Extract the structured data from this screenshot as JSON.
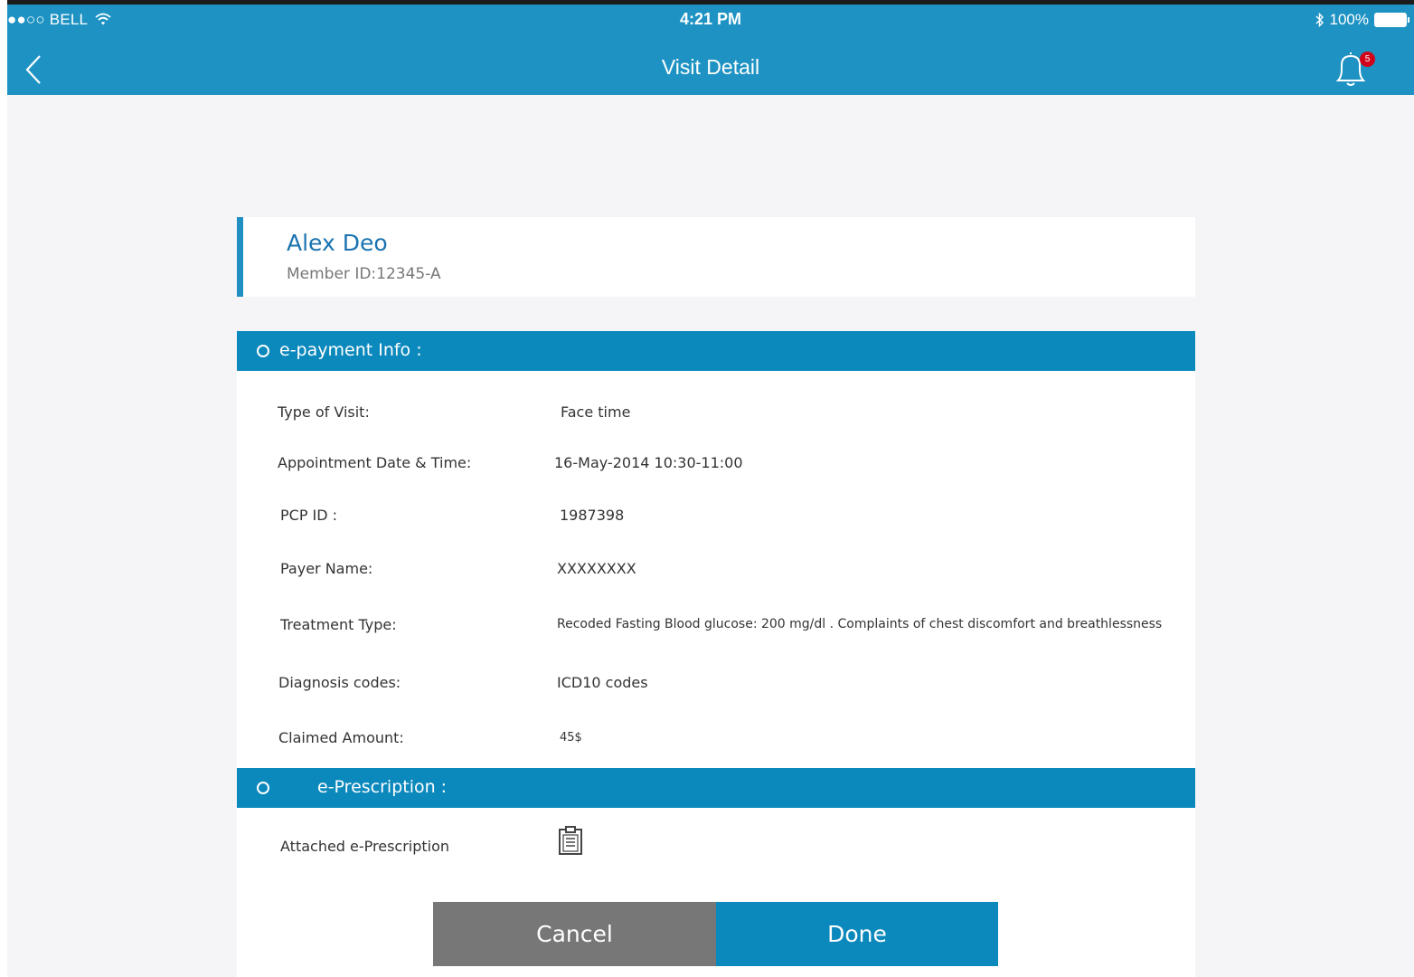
{
  "status_bar": {
    "carrier": "●●○○ BELL",
    "wifi_icon": "wifi-icon",
    "time": "4:21 PM",
    "bluetooth_icon": "bluetooth-icon",
    "battery": "100%"
  },
  "nav": {
    "title": "Visit Detail",
    "back_icon": "chevron-left-icon",
    "bell_icon": "bell-icon",
    "notification_count": "5"
  },
  "member": {
    "name": "Alex Deo",
    "member_id": "Member ID:12345-A"
  },
  "payment_section": {
    "title": "e-payment Info :",
    "rows": [
      {
        "label": "Type of Visit:",
        "value": "Face time"
      },
      {
        "label": "Appointment Date & Time:",
        "value": "16-May-2014 10:30-11:00"
      },
      {
        "label": "PCP ID :",
        "value": "1987398"
      },
      {
        "label": "Payer Name:",
        "value": "XXXXXXXX"
      },
      {
        "label": "Treatment Type:",
        "value": "Recoded Fasting Blood glucose: 200 mg/dl . Complaints of chest discomfort and breathlessness"
      },
      {
        "label": "Diagnosis codes:",
        "value": "ICD10 codes"
      },
      {
        "label": "Claimed Amount:",
        "value": "45$"
      }
    ]
  },
  "prescription_section": {
    "title": "e-Prescription :",
    "attached_label": "Attached e-Prescription",
    "attachment_icon": "clipboard-icon"
  },
  "actions": {
    "cancel_label": "Cancel",
    "done_label": "Done"
  },
  "colors": {
    "header": "#1e93c3",
    "section_bar": "#0b88bc",
    "accent_name": "#1a73b0",
    "cancel": "#777777",
    "badge": "#d0021b"
  }
}
